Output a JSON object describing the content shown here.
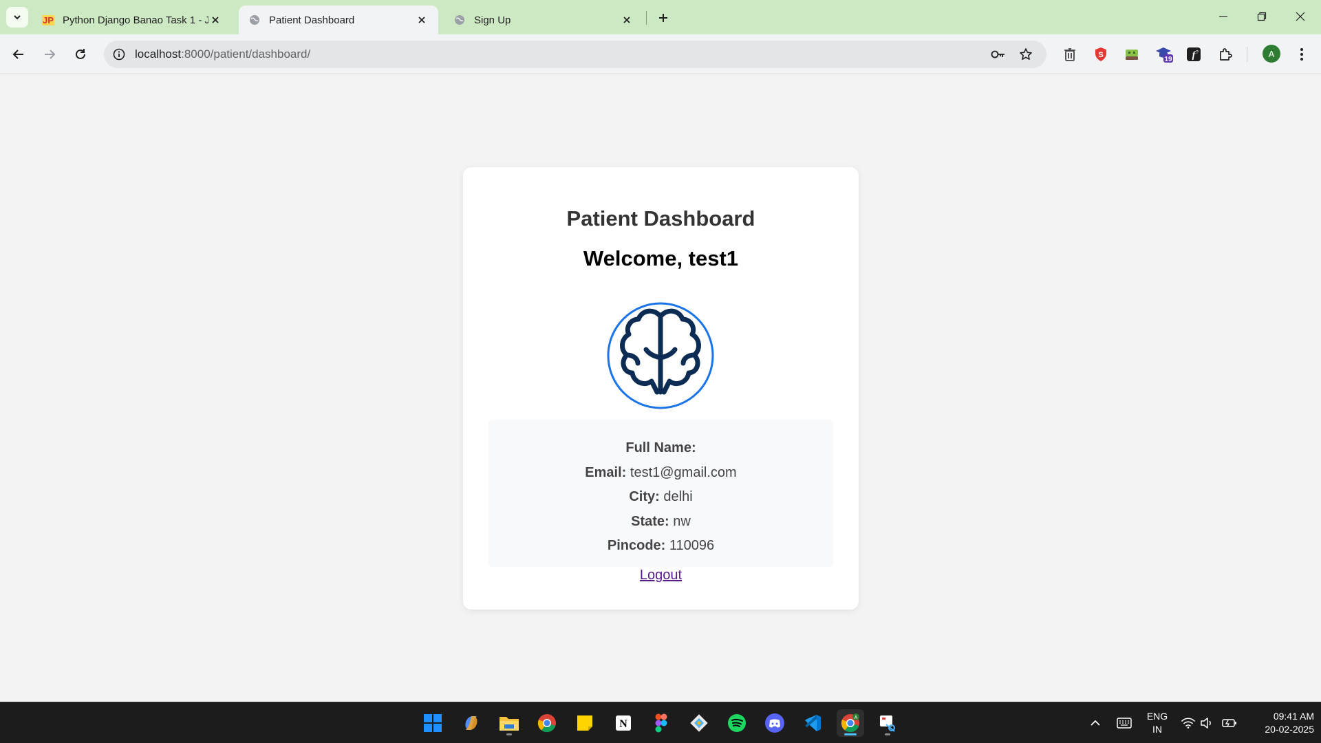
{
  "browser": {
    "tabs": [
      {
        "title": "Python Django Banao Task 1 - J",
        "favicon": "JP"
      },
      {
        "title": "Patient Dashboard"
      },
      {
        "title": "Sign Up"
      }
    ],
    "url_host": "localhost",
    "url_path": ":8000/patient/dashboard/",
    "extension_badge": "19",
    "profile_initial": "A"
  },
  "page": {
    "heading": "Patient Dashboard",
    "welcome": "Welcome, test1",
    "fields": {
      "full_name_label": "Full Name:",
      "full_name_value": "",
      "email_label": "Email:",
      "email_value": "test1@gmail.com",
      "city_label": "City:",
      "city_value": "delhi",
      "state_label": "State:",
      "state_value": "nw",
      "pincode_label": "Pincode:",
      "pincode_value": "110096"
    },
    "logout_label": "Logout"
  },
  "taskbar": {
    "apps": [
      "start-icon",
      "copilot-icon",
      "file-explorer-icon",
      "chrome-icon",
      "sticky-notes-icon",
      "notion-icon",
      "figma-icon",
      "git-icon",
      "spotify-icon",
      "discord-icon",
      "vscode-icon",
      "chrome-profile-icon",
      "snipping-tool-icon"
    ],
    "lang_line1": "ENG",
    "lang_line2": "IN",
    "time": "09:41 AM",
    "date": "20-02-2025"
  },
  "colors": {
    "tabbar": "#cde9c4",
    "link": "#551a8b",
    "brain_ring": "#1a73e8",
    "brain_stroke": "#0d2c54"
  }
}
